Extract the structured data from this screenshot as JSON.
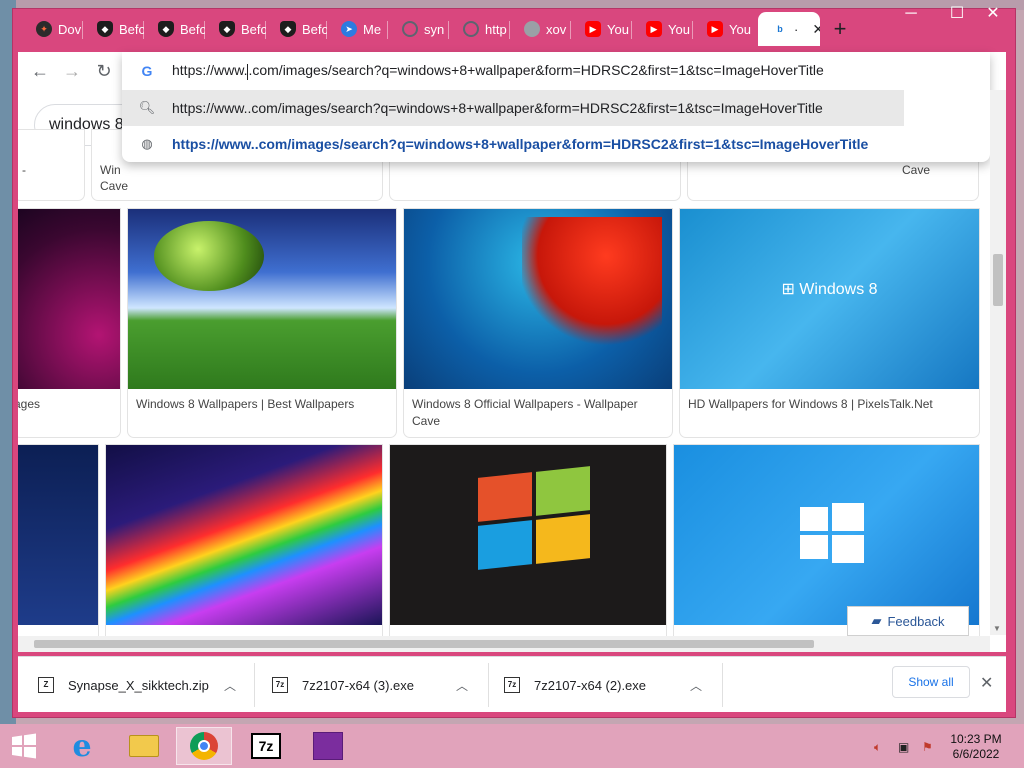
{
  "tabs": [
    {
      "label": "Dov",
      "icon": "swirl-icon",
      "cls": "ic-dark"
    },
    {
      "label": "Befo",
      "icon": "shield-icon",
      "cls": "ic-shield"
    },
    {
      "label": "Befo",
      "icon": "shield-icon",
      "cls": "ic-shield"
    },
    {
      "label": "Befo",
      "icon": "shield-icon",
      "cls": "ic-shield"
    },
    {
      "label": "Befo",
      "icon": "shield-icon",
      "cls": "ic-shield"
    },
    {
      "label": "Me",
      "icon": "telegram-icon",
      "cls": "ic-blue"
    },
    {
      "label": "syn",
      "icon": "globe-icon",
      "cls": "ic-globe"
    },
    {
      "label": "http",
      "icon": "globe-icon",
      "cls": "ic-globe"
    },
    {
      "label": "xov",
      "icon": "loading-icon",
      "cls": "ic-grey"
    },
    {
      "label": "You",
      "icon": "youtube-icon",
      "cls": "ic-yt"
    },
    {
      "label": "You",
      "icon": "youtube-icon",
      "cls": "ic-yt"
    },
    {
      "label": "You",
      "icon": "youtube-icon",
      "cls": "ic-yt"
    },
    {
      "label": "·",
      "icon": "bing-icon",
      "cls": "ic-bing",
      "active": true
    }
  ],
  "omnibox": {
    "input_before_caret": "https://www.",
    "input_after_caret": ".com/images/search?q=windows+8+wallpaper&form=HDRSC2&first=1&tsc=ImageHoverTitle",
    "suggestion_search": "https://www..com/images/search?q=windows+8+wallpaper&form=HDRSC2&first=1&tsc=ImageHoverTitle",
    "suggestion_url": "https://www..com/images/search?q=windows+8+wallpaper&form=HDRSC2&first=1&tsc=ImageHoverTitle"
  },
  "page": {
    "search_query": "windows 8",
    "top_captions": [
      "-",
      "Win",
      "Cave",
      "Cave"
    ],
    "row1_captions": [
      "ages",
      "Windows 8 Wallpapers | Best Wallpapers",
      "Windows 8 Official Wallpapers - Wallpaper Cave",
      "HD Wallpapers for Windows 8 | PixelsTalk.Net"
    ],
    "feedback_label": "Feedback"
  },
  "downloads": {
    "items": [
      {
        "name": "Synapse_X_sikktech.zip",
        "icon": "zip-file-icon"
      },
      {
        "name": "7z2107-x64 (3).exe",
        "icon": "7zip-file-icon"
      },
      {
        "name": "7z2107-x64 (2).exe",
        "icon": "7zip-file-icon"
      }
    ],
    "show_all_label": "Show all"
  },
  "taskbar": {
    "time": "10:23 PM",
    "date": "6/6/2022",
    "apps": [
      "internet-explorer-icon",
      "file-explorer-icon",
      "chrome-icon",
      "7zip-icon",
      "onenote-icon"
    ]
  },
  "colors": {
    "window_frame": "#d9477e",
    "taskbar": "#e1a3bb",
    "link_blue": "#1a73e8"
  }
}
